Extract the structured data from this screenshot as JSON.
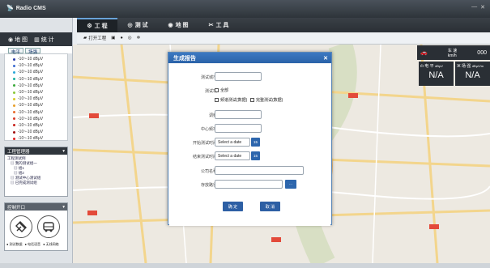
{
  "app": {
    "title": "Radio CMS"
  },
  "menu": [
    {
      "label": "工 程",
      "icon": "gear-icon"
    },
    {
      "label": "测 试",
      "icon": "gauge-icon"
    },
    {
      "label": "地 图",
      "icon": "globe-icon"
    },
    {
      "label": "工 具",
      "icon": "tools-icon"
    }
  ],
  "left": {
    "tabs": [
      {
        "label": "地 图"
      },
      {
        "label": "统 计"
      }
    ],
    "subtabs": [
      "电平",
      "场强"
    ],
    "signals": [
      {
        "text": "-10~-10 dBμV",
        "color": "#2a3aa8"
      },
      {
        "text": "-10~-10 dBμV",
        "color": "#3a6ad0"
      },
      {
        "text": "-10~-10 dBμV",
        "color": "#2aa6d8"
      },
      {
        "text": "-10~-10 dBμV",
        "color": "#1ab0a0"
      },
      {
        "text": "-10~-10 dBμV",
        "color": "#3aa83a"
      },
      {
        "text": "-10~-10 dBμV",
        "color": "#8ac83a"
      },
      {
        "text": "-10~-10 dBμV",
        "color": "#d8c82a"
      },
      {
        "text": "-10~-10 dBμV",
        "color": "#e8a02a"
      },
      {
        "text": "-10~-10 dBμV",
        "color": "#e86a2a"
      },
      {
        "text": "-10~-10 dBμV",
        "color": "#d83a2a"
      },
      {
        "text": "-10~-10 dBμV",
        "color": "#c8201a"
      },
      {
        "text": "-10~-10 dBμV",
        "color": "#a01010"
      },
      {
        "text": "-10~-10 dBμV",
        "color": "#e02020"
      }
    ],
    "project_header": "工程管理器",
    "tree": [
      "工程测试例",
      "▤ 我的测试组一",
      "▤ 组1",
      "▤ 组2",
      "▤ 测试中心测试组",
      "▤ 已完成测试组"
    ],
    "control_header": "控制开口",
    "legend": [
      "● 测试数据",
      "● 电话语音",
      "● 无线网络"
    ]
  },
  "toolbar": [
    {
      "label": "打开工程",
      "icon": "folder-icon"
    },
    {
      "label": "",
      "icon": "save-icon"
    },
    {
      "label": "",
      "icon": "globe-small-icon"
    },
    {
      "label": "",
      "icon": "target-icon"
    },
    {
      "label": "",
      "icon": "flower-icon"
    }
  ],
  "hud": {
    "row1_label": "车 速",
    "row1_unit": "km/h",
    "row1_value": "000",
    "cells": [
      {
        "label": "电 平",
        "unit": "dBμV",
        "value": "N/A"
      },
      {
        "label": "场 强",
        "unit": "dBμV/m",
        "value": "N/A"
      }
    ]
  },
  "dialog": {
    "title": "生成报告",
    "fields": {
      "test_name": {
        "label": "测试城市",
        "value": ""
      },
      "freq_label": "测试项",
      "check_all": "全部",
      "check_a": "频谱测试(数据)",
      "check_b": "完整测试(数据)",
      "range": {
        "label": "调频",
        "value": ""
      },
      "center": {
        "label": "中心频率",
        "value": ""
      },
      "start": {
        "label": "开始测试时间",
        "placeholder": "Select a date"
      },
      "end": {
        "label": "结束测试时间",
        "placeholder": "Select a date"
      },
      "company": {
        "label": "公司名称",
        "value": ""
      },
      "save_path": {
        "label": "存放路径",
        "value": ""
      }
    },
    "buttons": {
      "ok": "确 定",
      "cancel": "取 消",
      "browse": "···"
    }
  },
  "colors": {
    "accent": "#2d5fa4",
    "dark": "#2a2f35"
  }
}
